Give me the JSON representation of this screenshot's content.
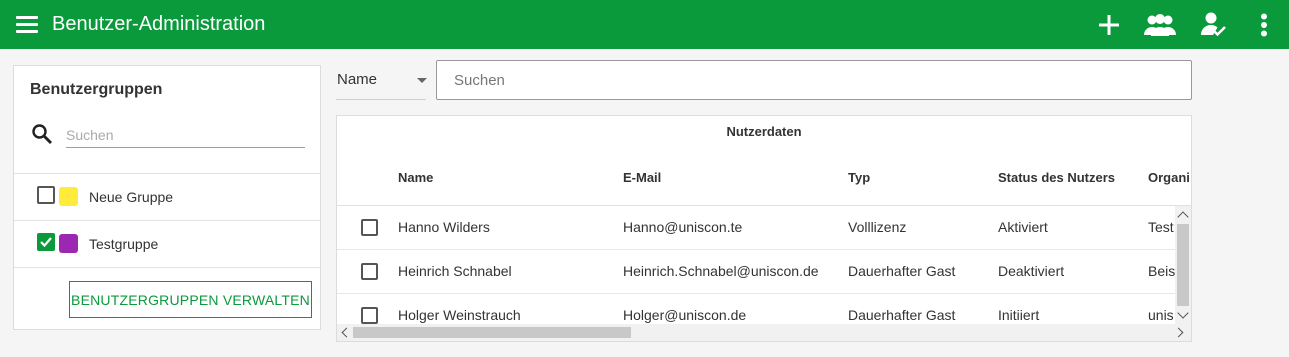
{
  "appbar": {
    "title": "Benutzer-Administration",
    "menu_icon": "hamburger-menu-icon",
    "actions": [
      {
        "name": "add-icon"
      },
      {
        "name": "user-group-icon"
      },
      {
        "name": "user-check-icon"
      },
      {
        "name": "more-vertical-icon"
      }
    ],
    "color": "#0a9a3c"
  },
  "groups_panel": {
    "title": "Benutzergruppen",
    "search_placeholder": "Suchen",
    "groups": [
      {
        "label": "Neue Gruppe",
        "checked": false,
        "color": "#ffeb3b"
      },
      {
        "label": "Testgruppe",
        "checked": true,
        "color": "#9c27b0"
      }
    ],
    "manage_button": "BENUTZERGRUPPEN VERWALTEN"
  },
  "filter": {
    "selected": "Name",
    "search_placeholder": "Suchen"
  },
  "table": {
    "group_header": "Nutzerdaten",
    "columns": [
      "Name",
      "E-Mail",
      "Typ",
      "Status des Nutzers",
      "Organi"
    ],
    "rows": [
      {
        "name": "Hanno Wilders",
        "email": "Hanno@uniscon.te",
        "type": "Volllizenz",
        "status": "Aktiviert",
        "org": "Test"
      },
      {
        "name": "Heinrich Schnabel",
        "email": "Heinrich.Schnabel@uniscon.de",
        "type": "Dauerhafter Gast",
        "status": "Deaktiviert",
        "org": "Beis"
      },
      {
        "name": "Holger Weinstrauch",
        "email": "Holger@uniscon.de",
        "type": "Dauerhafter Gast",
        "status": "Initiiert",
        "org": "unis"
      }
    ]
  }
}
